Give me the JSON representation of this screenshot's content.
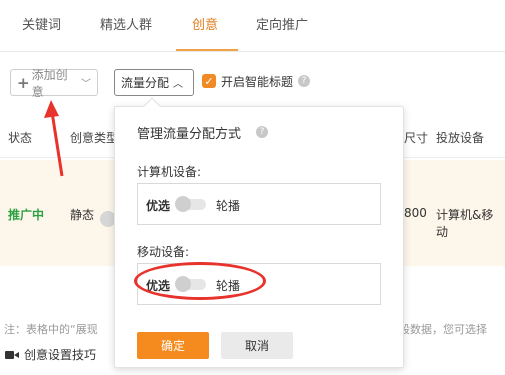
{
  "tabs": [
    "关键词",
    "精选人群",
    "创意",
    "定向推广"
  ],
  "toolbar": {
    "add_label": "添加创意",
    "traffic_label": "流量分配",
    "smart_title_label": "开启智能标题",
    "smart_title_checked": true
  },
  "table": {
    "headers": {
      "status": "状态",
      "type": "创意类型",
      "size": "尺寸",
      "device": "投放设备"
    },
    "row": {
      "status": "推广中",
      "type": "静态",
      "size": "800",
      "device": "计算机&移动"
    }
  },
  "popover": {
    "title": "管理流量分配方式",
    "pc_label": "计算机设备:",
    "mobile_label": "移动设备:",
    "option_left": "优选",
    "option_right": "轮播",
    "confirm": "确定",
    "cancel": "取消"
  },
  "footer": {
    "note": "注：表格中的“展现",
    "note_right": "间段数据，您可选择",
    "tips": "创意设置技巧"
  },
  "colors": {
    "accent": "#f58b1f",
    "active_tab": "#e07c1b",
    "status_green": "#2ea043",
    "annotation_red": "#e8322c"
  }
}
